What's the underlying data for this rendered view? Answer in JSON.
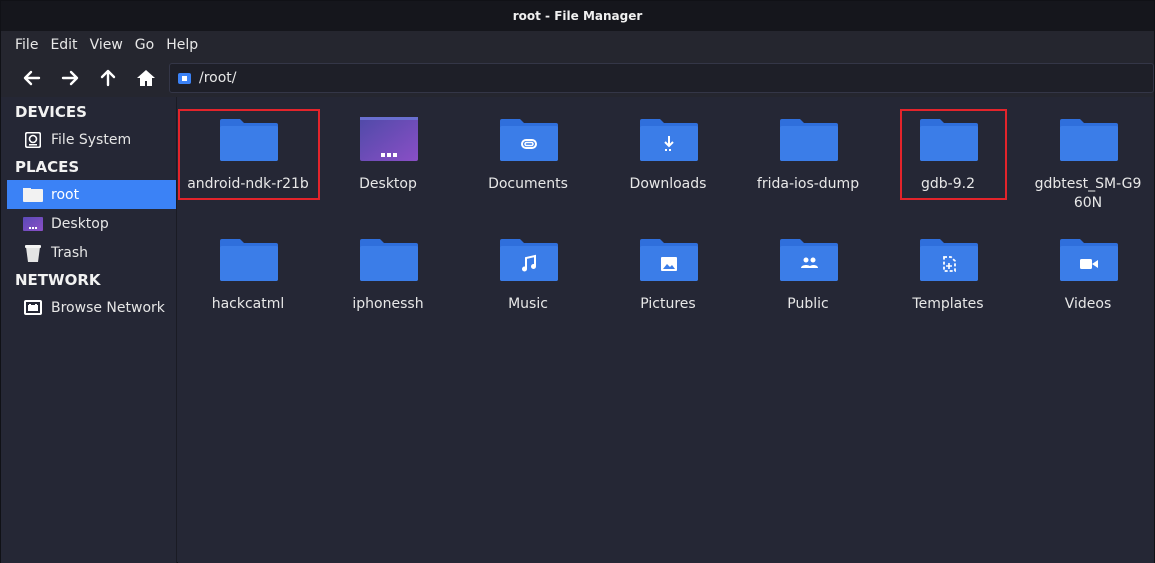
{
  "window": {
    "title": "root - File Manager"
  },
  "menu": [
    "File",
    "Edit",
    "View",
    "Go",
    "Help"
  ],
  "location": {
    "path": "/root/"
  },
  "sidebar": {
    "devices_heading": "DEVICES",
    "devices": [
      {
        "label": "File System",
        "icon": "drive-icon"
      }
    ],
    "places_heading": "PLACES",
    "places": [
      {
        "label": "root",
        "icon": "home-folder-icon",
        "active": true
      },
      {
        "label": "Desktop",
        "icon": "desktop-icon"
      },
      {
        "label": "Trash",
        "icon": "trash-icon"
      }
    ],
    "network_heading": "NETWORK",
    "network": [
      {
        "label": "Browse Network",
        "icon": "network-icon"
      }
    ]
  },
  "files": [
    {
      "name": "android-ndk-r21b",
      "icon": "folder-icon",
      "highlighted": true
    },
    {
      "name": "Desktop",
      "icon": "desktop-folder-icon"
    },
    {
      "name": "Documents",
      "icon": "documents-folder-icon"
    },
    {
      "name": "Downloads",
      "icon": "downloads-folder-icon"
    },
    {
      "name": "frida-ios-dump",
      "icon": "folder-icon"
    },
    {
      "name": "gdb-9.2",
      "icon": "folder-icon",
      "highlighted": true
    },
    {
      "name": "gdbtest_SM-G960N",
      "icon": "folder-icon"
    },
    {
      "name": "hackcatml",
      "icon": "folder-icon"
    },
    {
      "name": "iphonessh",
      "icon": "folder-icon"
    },
    {
      "name": "Music",
      "icon": "music-folder-icon"
    },
    {
      "name": "Pictures",
      "icon": "pictures-folder-icon"
    },
    {
      "name": "Public",
      "icon": "public-folder-icon"
    },
    {
      "name": "Templates",
      "icon": "templates-folder-icon"
    },
    {
      "name": "Videos",
      "icon": "videos-folder-icon"
    }
  ],
  "colors": {
    "accent": "#3b82f6",
    "folder": "#3b7de8",
    "highlight": "#e3242b"
  }
}
